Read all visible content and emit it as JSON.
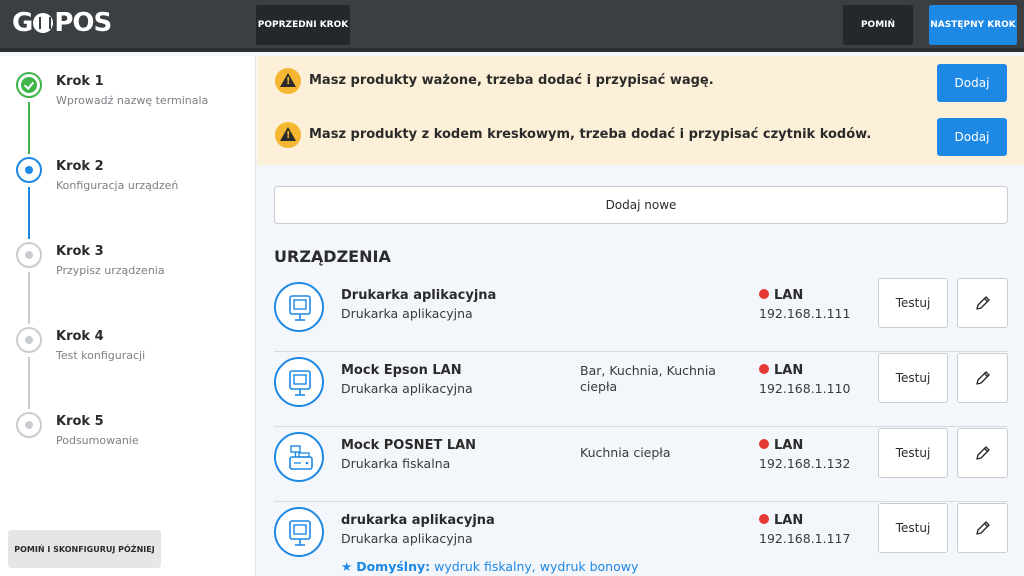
{
  "app": {
    "logo_text": "GOPOS"
  },
  "topbar": {
    "prev_label": "POPRZEDNI KROK",
    "skip_label": "POMIŃ",
    "next_label": "NASTĘPNY KROK"
  },
  "colors": {
    "accent": "#1e88e5",
    "success": "#3fb54a",
    "warning": "#f5b731",
    "offline": "#e53935",
    "topbar": "#3a3f44"
  },
  "steps": [
    {
      "title": "Krok 1",
      "subtitle": "Wprowadź nazwę terminala",
      "state": "done"
    },
    {
      "title": "Krok 2",
      "subtitle": "Konfiguracja urządzeń",
      "state": "active"
    },
    {
      "title": "Krok 3",
      "subtitle": "Przypisz urządzenia",
      "state": "pending"
    },
    {
      "title": "Krok 4",
      "subtitle": "Test konfiguracji",
      "state": "pending"
    },
    {
      "title": "Krok 5",
      "subtitle": "Podsumowanie",
      "state": "pending"
    }
  ],
  "sidebar": {
    "skip_later_label": "POMIŃ I SKONFIGURUJ PÓŹNIEJ"
  },
  "alerts": [
    {
      "icon": "warning-icon",
      "text": "Masz produkty ważone, trzeba dodać i przypisać wagę.",
      "button": "Dodaj"
    },
    {
      "icon": "warning-icon",
      "text": "Masz produkty z kodem kreskowym, trzeba dodać i przypisać czytnik kodów.",
      "button": "Dodaj"
    }
  ],
  "main": {
    "add_new_label": "Dodaj nowe",
    "section_title": "URZĄDZENIA",
    "test_label": "Testuj",
    "devices": [
      {
        "name": "Drukarka aplikacyjna",
        "type": "Drukarka aplikacyjna",
        "locations": "",
        "connection": "LAN",
        "ip": "192.168.1.111",
        "icon": "printer-icon"
      },
      {
        "name": "Mock Epson LAN",
        "type": "Drukarka aplikacyjna",
        "locations": "Bar, Kuchnia, Kuchnia ciepła",
        "connection": "LAN",
        "ip": "192.168.1.110",
        "icon": "printer-icon"
      },
      {
        "name": "Mock POSNET LAN",
        "type": "Drukarka fiskalna",
        "locations": "Kuchnia ciepła",
        "connection": "LAN",
        "ip": "192.168.1.132",
        "icon": "fiscal-printer-icon"
      },
      {
        "name": "drukarka aplikacyjna",
        "type": "Drukarka aplikacyjna",
        "locations": "",
        "connection": "LAN",
        "ip": "192.168.1.117",
        "icon": "printer-icon",
        "default_label": "Domyślny:",
        "default_value": "wydruk fiskalny, wydruk bonowy"
      }
    ]
  }
}
